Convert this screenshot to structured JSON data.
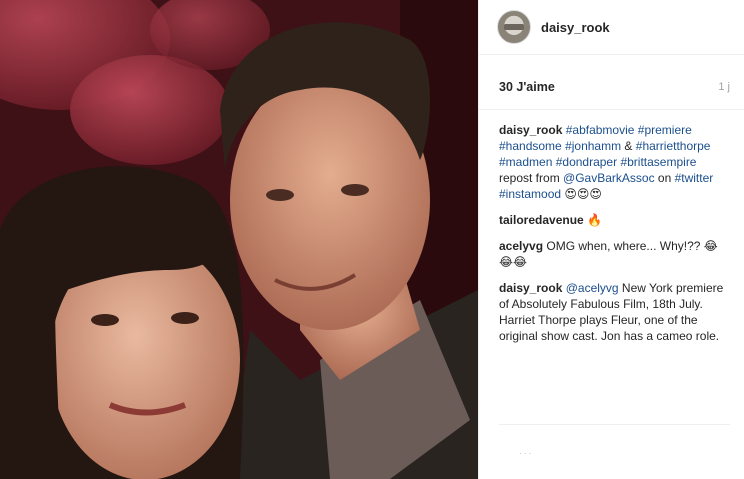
{
  "post": {
    "username": "daisy_rook",
    "likes": "30 J'aime",
    "time": "1 j"
  },
  "caption": {
    "user": "daisy_rook",
    "segments": [
      {
        "text": "#abfabmovie",
        "type": "tag"
      },
      {
        "text": " ",
        "type": "text"
      },
      {
        "text": "#premiere",
        "type": "tag"
      },
      {
        "text": " ",
        "type": "text"
      },
      {
        "text": "#handsome",
        "type": "tag"
      },
      {
        "text": " ",
        "type": "text"
      },
      {
        "text": "#jonhamm",
        "type": "tag"
      },
      {
        "text": " & ",
        "type": "text"
      },
      {
        "text": "#harrietthorpe",
        "type": "tag"
      },
      {
        "text": " ",
        "type": "text"
      },
      {
        "text": "#madmen",
        "type": "tag"
      },
      {
        "text": " ",
        "type": "text"
      },
      {
        "text": "#dondraper",
        "type": "tag"
      },
      {
        "text": " ",
        "type": "text"
      },
      {
        "text": "#brittasempire",
        "type": "tag"
      },
      {
        "text": " repost from ",
        "type": "text"
      },
      {
        "text": "@GavBarkAssoc",
        "type": "tag"
      },
      {
        "text": " on ",
        "type": "text"
      },
      {
        "text": "#twitter",
        "type": "tag"
      },
      {
        "text": " ",
        "type": "text"
      },
      {
        "text": "#instamood",
        "type": "tag"
      },
      {
        "text": " 😍😍😍",
        "type": "text"
      }
    ]
  },
  "comments": [
    {
      "user": "tailoredavenue",
      "text": "🔥"
    },
    {
      "user": "acelyvg",
      "text": "OMG when, where... Why!?? 😂😂😂"
    }
  ],
  "reply": {
    "user": "daisy_rook",
    "mention": "@acelyvg",
    "text": " New York premiere of Absolutely Fabulous Film, 18th July. Harriet Thorpe plays Fleur, one of the original show cast. Jon has a cameo role."
  },
  "add_comment_placeholder": "...",
  "colors": {
    "link": "#1b4f8d",
    "text": "#262626",
    "muted": "#a3a3a3"
  }
}
